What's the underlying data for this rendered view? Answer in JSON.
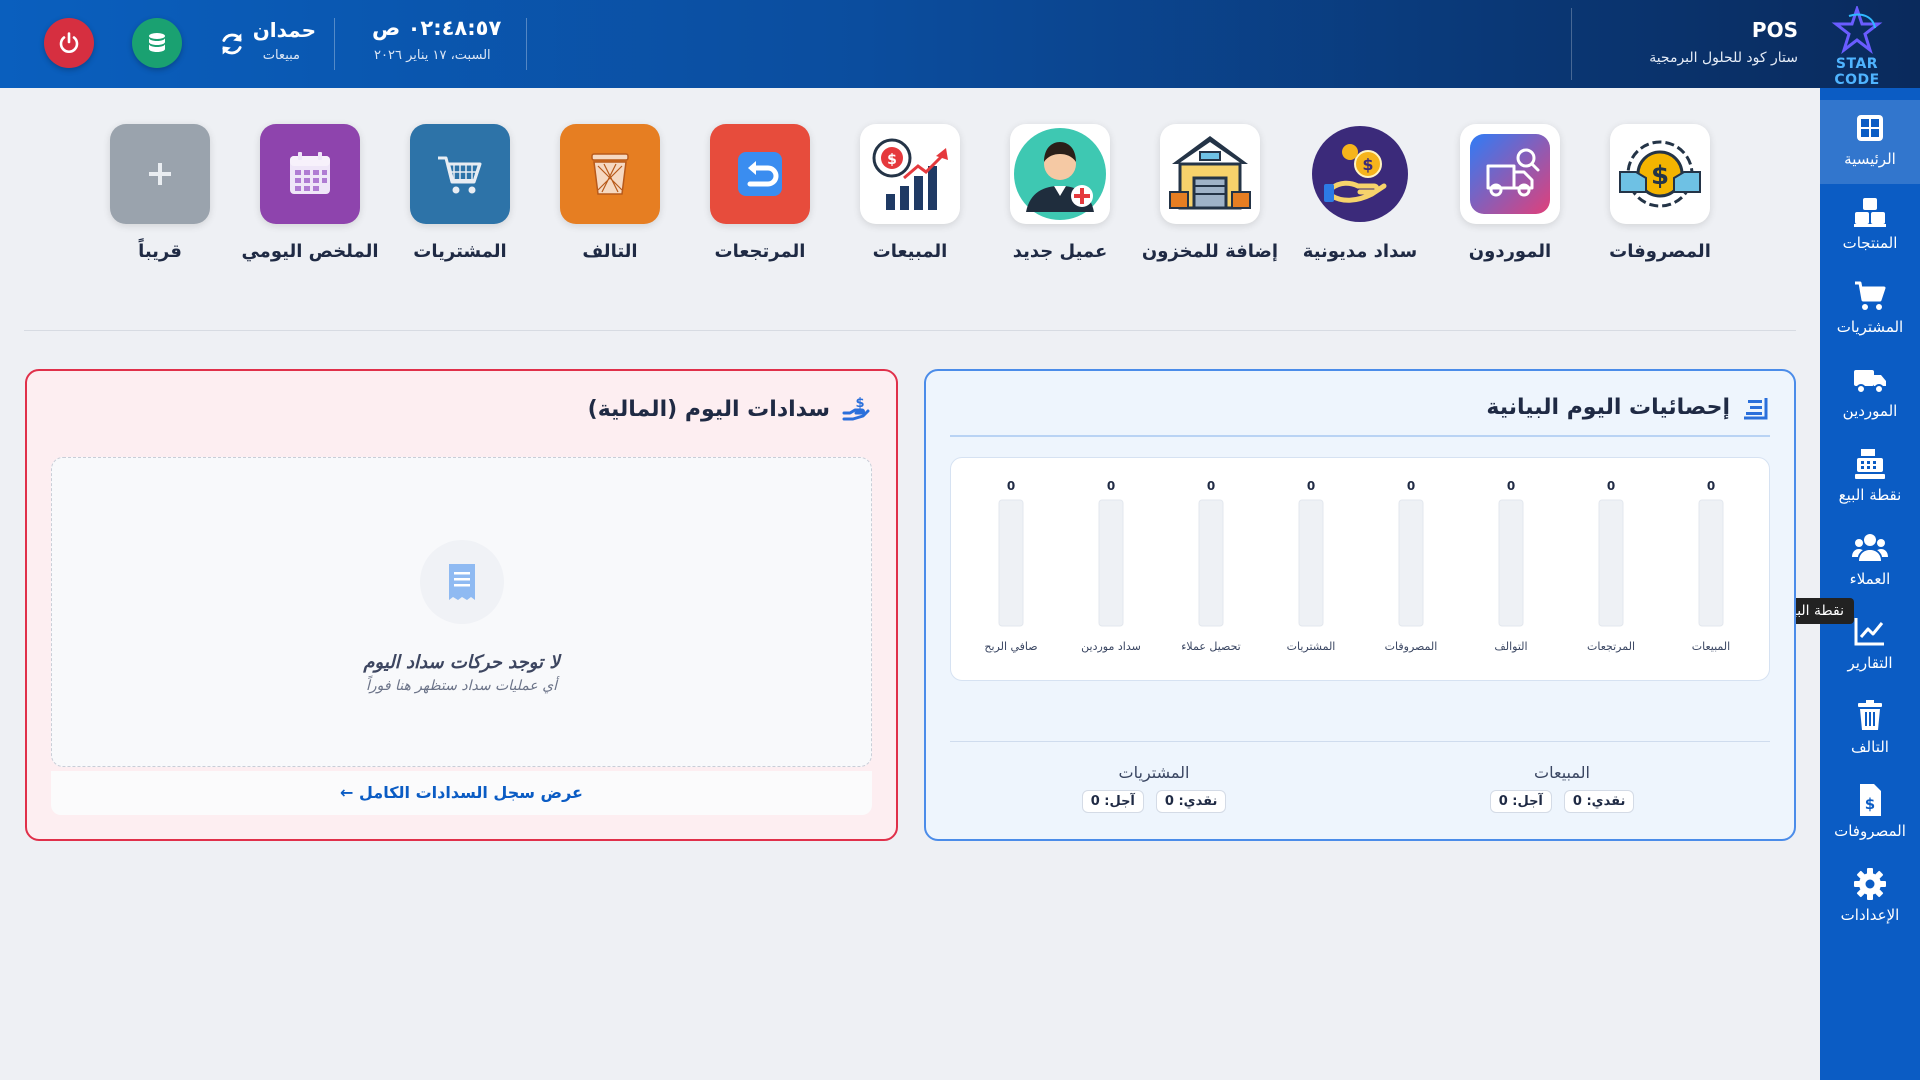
{
  "header": {
    "brand_name": "POS",
    "brand_subtitle": "ستار كود للحلول البرمجية",
    "logo_text": "STAR CODE",
    "clock": "٠٢:٤٨:٥٧ ص",
    "date": "السبت، ١٧ يناير ٢٠٢٦",
    "user_name": "حمدان",
    "user_role": "مبيعات",
    "icons": {
      "power": "power-icon",
      "database": "database-icon",
      "sync": "sync-icon"
    },
    "colors": {
      "power": "#d62f40",
      "database": "#1aa171"
    }
  },
  "sidebar": {
    "items": [
      {
        "label": "الرئيسية",
        "icon": "dashboard-icon",
        "active": true
      },
      {
        "label": "المنتجات",
        "icon": "boxes-icon"
      },
      {
        "label": "المشتريات",
        "icon": "cart-icon"
      },
      {
        "label": "الموردين",
        "icon": "truck-icon"
      },
      {
        "label": "نقطة البيع",
        "icon": "cash-register-icon"
      },
      {
        "label": "العملاء",
        "icon": "users-icon"
      },
      {
        "label": "التقارير",
        "icon": "chart-line-icon"
      },
      {
        "label": "التالف",
        "icon": "trash-icon"
      },
      {
        "label": "المصروفات",
        "icon": "invoice-dollar-icon"
      },
      {
        "label": "الإعدادات",
        "icon": "gear-icon"
      }
    ],
    "tooltip": "نقطة البيع"
  },
  "quick_actions": [
    {
      "label": "المصروفات",
      "icon": "expenses-icon"
    },
    {
      "label": "الموردون",
      "icon": "suppliers-icon"
    },
    {
      "label": "سداد مديونية",
      "icon": "debt-payment-icon"
    },
    {
      "label": "إضافة للمخزون",
      "icon": "warehouse-icon"
    },
    {
      "label": "عميل جديد",
      "icon": "new-customer-icon"
    },
    {
      "label": "المبيعات",
      "icon": "sales-chart-icon"
    },
    {
      "label": "المرتجعات",
      "icon": "returns-icon"
    },
    {
      "label": "التالف",
      "icon": "damaged-bin-icon"
    },
    {
      "label": "المشتريات",
      "icon": "purchases-cart-icon"
    },
    {
      "label": "الملخص اليومي",
      "icon": "calendar-icon"
    },
    {
      "label": "قريباً",
      "icon": "plus-icon"
    }
  ],
  "stats_panel": {
    "title": "إحصائيات اليوم البيانية",
    "totals": {
      "sales": {
        "title": "المبيعات",
        "cash": "نقدي: 0",
        "credit": "آجل: 0"
      },
      "purchases": {
        "title": "المشتريات",
        "cash": "نقدي: 0",
        "credit": "آجل: 0"
      }
    }
  },
  "chart_data": {
    "type": "bar",
    "categories": [
      "المبيعات",
      "المرتجعات",
      "التوالف",
      "المصروفات",
      "المشتريات",
      "تحصيل عملاء",
      "سداد موردين",
      "صافي الربح"
    ],
    "values": [
      0,
      0,
      0,
      0,
      0,
      0,
      0,
      0
    ],
    "value_labels": [
      "0",
      "0",
      "0",
      "0",
      "0",
      "0",
      "0",
      "0"
    ],
    "grid": false,
    "bar_color": "#eef1f5"
  },
  "payments_panel": {
    "title": "سدادات اليوم (المالية)",
    "empty_title": "لا توجد حركات سداد اليوم",
    "empty_sub": "أي عمليات سداد ستظهر هنا فوراً",
    "view_all": "عرض سجل السدادات الكامل"
  }
}
